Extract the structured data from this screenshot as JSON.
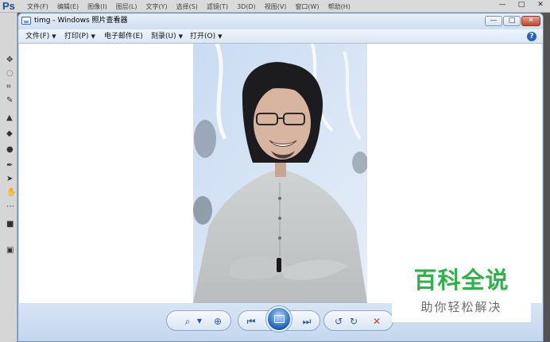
{
  "ps": {
    "logo": "Ps",
    "menu": [
      "文件(F)",
      "编辑(E)",
      "图像(I)",
      "图层(L)",
      "文字(Y)",
      "选择(S)",
      "滤镜(T)",
      "3D(D)",
      "视图(V)",
      "窗口(W)",
      "帮助(H)"
    ],
    "window_buttons": [
      "—",
      "□",
      "✕"
    ]
  },
  "viewer": {
    "title": "timg - Windows 照片查看器",
    "controls": {
      "minimize": "—",
      "maximize": "□",
      "close": "✕"
    },
    "menu": [
      {
        "label": "文件(F)",
        "dropdown": true
      },
      {
        "label": "打印(P)",
        "dropdown": true
      },
      {
        "label": "电子邮件(E)",
        "dropdown": false
      },
      {
        "label": "刻录(U)",
        "dropdown": true
      },
      {
        "label": "打开(O)",
        "dropdown": true
      }
    ],
    "help_icon": "?"
  },
  "toolbar": {
    "zoom_icon": "⌕",
    "actual_size_icon": "⊕",
    "previous_icon": "⏮",
    "next_icon": "⏭",
    "rotate_ccw_icon": "↺",
    "rotate_cw_icon": "↻",
    "delete_icon": "✕"
  },
  "watermark": {
    "title": "百科全说",
    "subtitle": "助你轻松解决"
  },
  "colors": {
    "watermark_green": "#2fb24a",
    "delete_red": "#d23b2e",
    "toolbar_blue": "#2a5b9a"
  }
}
